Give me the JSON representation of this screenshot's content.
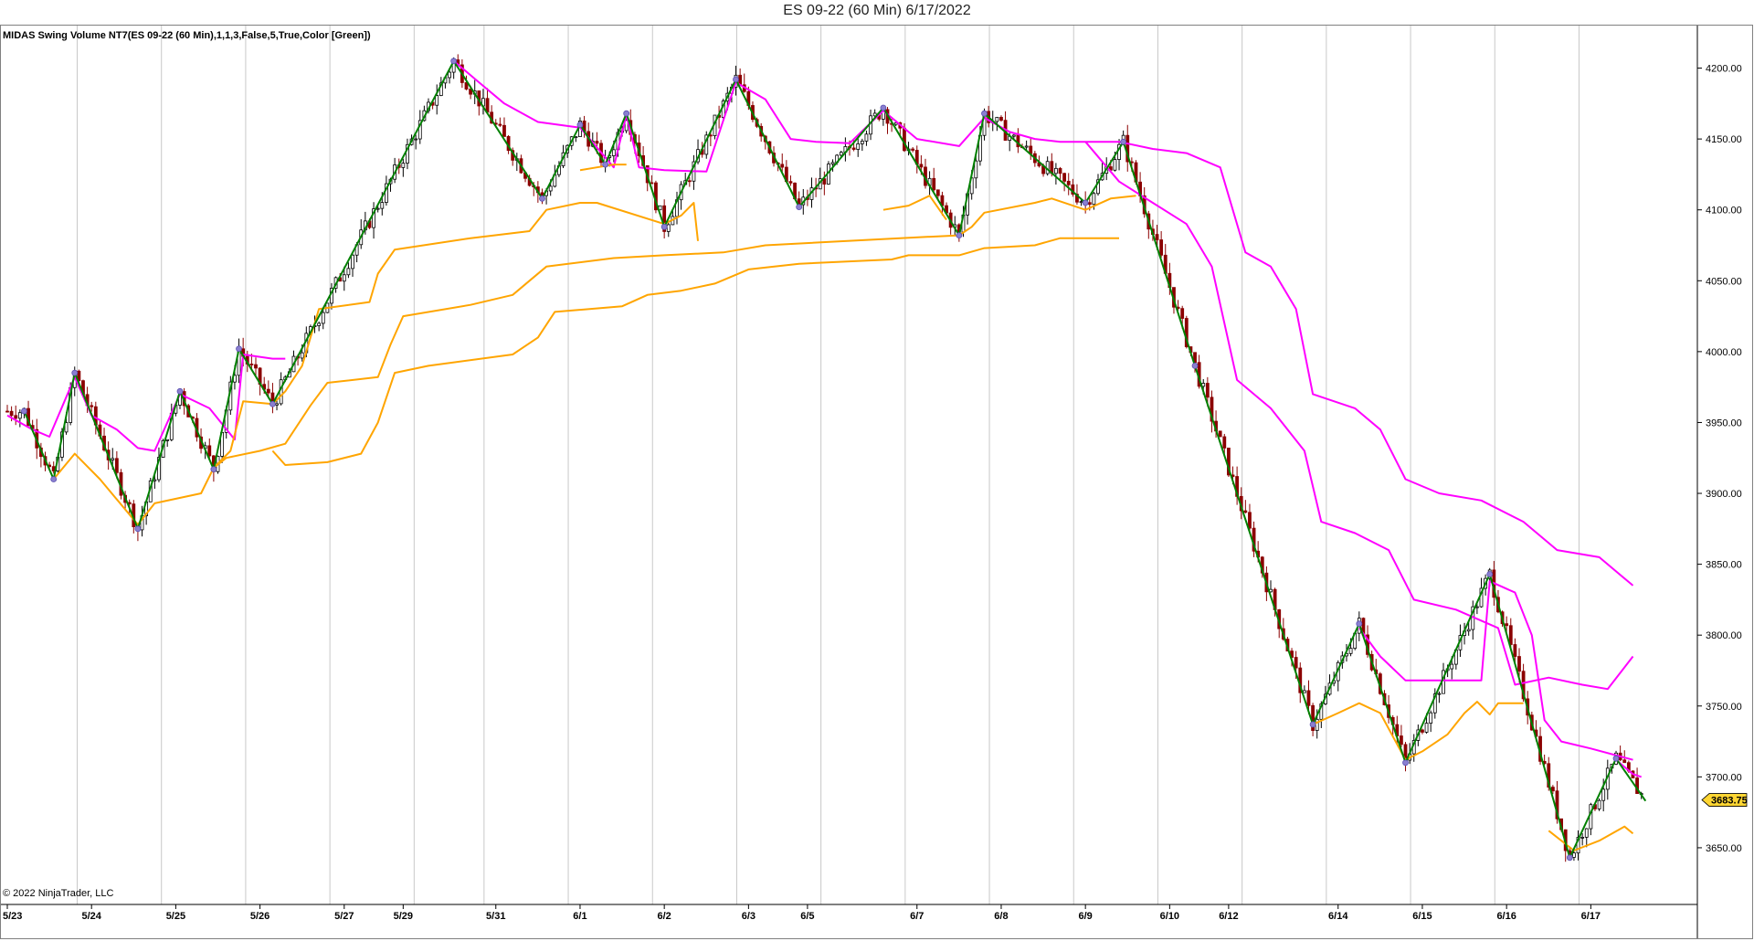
{
  "window": {
    "title": "ES 09-22 (60 Min)  6/17/2022"
  },
  "indicator": {
    "label": "MIDAS Swing Volume NT7(ES 09-22 (60 Min),1,1,3,False,5,True,Color [Green])"
  },
  "footer": {
    "copyright": "© 2022 NinjaTrader, LLC"
  },
  "colors": {
    "swing": "#008000",
    "resistance": "#ff00ff",
    "support": "#ffa500",
    "candle_up": "#000000",
    "candle_down": "#8b0000",
    "pivot_marker": "#8a7fd0",
    "price_tag": "#ffd633",
    "grid": "#c8c8c8"
  },
  "chart_data": {
    "type": "line",
    "ylim": [
      3610,
      4230
    ],
    "y_ticks": [
      "4200.00",
      "4150.00",
      "4100.00",
      "4050.00",
      "4000.00",
      "3950.00",
      "3900.00",
      "3850.00",
      "3800.00",
      "3750.00",
      "3700.00",
      "3650.00"
    ],
    "y_tick_values": [
      4200,
      4150,
      4100,
      4050,
      4000,
      3950,
      3900,
      3850,
      3800,
      3750,
      3700,
      3650
    ],
    "x_session_count": 19,
    "date_labels": [
      {
        "label": "5/23",
        "session": 0
      },
      {
        "label": "5/24",
        "session": 1
      },
      {
        "label": "5/25",
        "session": 2
      },
      {
        "label": "5/26",
        "session": 3
      },
      {
        "label": "5/27",
        "session": 4
      },
      {
        "label": "5/29",
        "session": 4.7
      },
      {
        "label": "5/31",
        "session": 5.8
      },
      {
        "label": "6/1",
        "session": 6.8
      },
      {
        "label": "6/2",
        "session": 7.8
      },
      {
        "label": "6/3",
        "session": 8.8
      },
      {
        "label": "6/5",
        "session": 9.5
      },
      {
        "label": "6/7",
        "session": 10.8
      },
      {
        "label": "6/8",
        "session": 11.8
      },
      {
        "label": "6/9",
        "session": 12.8
      },
      {
        "label": "6/10",
        "session": 13.8
      },
      {
        "label": "6/12",
        "session": 14.5
      },
      {
        "label": "6/14",
        "session": 15.8
      },
      {
        "label": "6/15",
        "session": 16.8
      },
      {
        "label": "6/16",
        "session": 17.8
      },
      {
        "label": "6/17",
        "session": 18.8
      }
    ],
    "session_lines": [
      0.83,
      1.83,
      2.83,
      3.83,
      4.83,
      5.66,
      6.66,
      7.66,
      8.66,
      9.66,
      10.66,
      11.66,
      12.66,
      13.66,
      14.66,
      15.66,
      16.66,
      17.66,
      18.66
    ],
    "last_price": "3683.75",
    "swing_pivots": [
      {
        "t": 0.2,
        "p": 3958
      },
      {
        "t": 0.55,
        "p": 3910
      },
      {
        "t": 0.8,
        "p": 3985
      },
      {
        "t": 1.55,
        "p": 3875
      },
      {
        "t": 2.05,
        "p": 3972
      },
      {
        "t": 2.45,
        "p": 3917
      },
      {
        "t": 2.75,
        "p": 4002
      },
      {
        "t": 3.15,
        "p": 3963
      },
      {
        "t": 5.3,
        "p": 4205
      },
      {
        "t": 6.35,
        "p": 4108
      },
      {
        "t": 6.8,
        "p": 4160
      },
      {
        "t": 7.1,
        "p": 4132
      },
      {
        "t": 7.35,
        "p": 4168
      },
      {
        "t": 7.8,
        "p": 4088
      },
      {
        "t": 8.65,
        "p": 4192
      },
      {
        "t": 9.4,
        "p": 4102
      },
      {
        "t": 10.4,
        "p": 4172
      },
      {
        "t": 11.3,
        "p": 4082
      },
      {
        "t": 11.6,
        "p": 4168
      },
      {
        "t": 12.8,
        "p": 4105
      },
      {
        "t": 13.25,
        "p": 4148
      },
      {
        "t": 14.1,
        "p": 3990
      },
      {
        "t": 15.5,
        "p": 3737
      },
      {
        "t": 16.05,
        "p": 3808
      },
      {
        "t": 16.6,
        "p": 3710
      },
      {
        "t": 17.6,
        "p": 3843
      },
      {
        "t": 18.55,
        "p": 3643
      },
      {
        "t": 19.1,
        "p": 3713
      },
      {
        "t": 19.45,
        "p": 3683
      }
    ],
    "series": [
      {
        "name": "",
        "color": "resistance",
        "points": [
          [
            0,
            3955
          ],
          [
            0.3,
            3945
          ],
          [
            0.5,
            3940
          ],
          [
            0.8,
            3982
          ],
          [
            1.0,
            3955
          ],
          [
            1.3,
            3945
          ],
          [
            1.55,
            3932
          ],
          [
            1.75,
            3930
          ],
          [
            2.05,
            3970
          ],
          [
            2.4,
            3960
          ],
          [
            2.7,
            3938
          ],
          [
            2.8,
            3998
          ],
          [
            3.15,
            3995
          ],
          [
            3.3,
            3995
          ]
        ]
      },
      {
        "name": "",
        "color": "resistance",
        "points": [
          [
            5.3,
            4205
          ],
          [
            5.6,
            4190
          ],
          [
            5.9,
            4175
          ],
          [
            6.3,
            4162
          ],
          [
            6.8,
            4158
          ],
          [
            7.2,
            4130
          ],
          [
            7.35,
            4167
          ],
          [
            7.5,
            4130
          ],
          [
            7.8,
            4128
          ],
          [
            8.3,
            4127
          ],
          [
            8.65,
            4190
          ],
          [
            9.0,
            4178
          ],
          [
            9.3,
            4150
          ],
          [
            9.6,
            4148
          ],
          [
            10.0,
            4147
          ],
          [
            10.4,
            4170
          ],
          [
            10.8,
            4150
          ],
          [
            11.3,
            4145
          ],
          [
            11.6,
            4165
          ],
          [
            11.9,
            4155
          ],
          [
            12.2,
            4150
          ],
          [
            12.5,
            4148
          ],
          [
            13.2,
            4148
          ],
          [
            13.6,
            4143
          ],
          [
            14.0,
            4140
          ],
          [
            14.4,
            4130
          ],
          [
            14.7,
            4070
          ],
          [
            15.0,
            4060
          ],
          [
            15.3,
            4030
          ],
          [
            15.5,
            3970
          ],
          [
            16.0,
            3960
          ],
          [
            16.3,
            3945
          ],
          [
            16.6,
            3910
          ],
          [
            17.0,
            3900
          ],
          [
            17.5,
            3895
          ],
          [
            18.0,
            3880
          ],
          [
            18.4,
            3860
          ],
          [
            18.9,
            3855
          ],
          [
            19.3,
            3835
          ]
        ]
      },
      {
        "name": "",
        "color": "resistance",
        "points": [
          [
            12.8,
            4148
          ],
          [
            13.2,
            4120
          ],
          [
            13.6,
            4105
          ],
          [
            14.0,
            4090
          ],
          [
            14.3,
            4060
          ],
          [
            14.6,
            3980
          ],
          [
            15.0,
            3960
          ],
          [
            15.4,
            3930
          ],
          [
            15.6,
            3880
          ],
          [
            16.0,
            3872
          ],
          [
            16.4,
            3860
          ],
          [
            16.7,
            3825
          ],
          [
            17.2,
            3818
          ],
          [
            17.7,
            3805
          ],
          [
            17.9,
            3765
          ],
          [
            18.3,
            3770
          ],
          [
            18.7,
            3765
          ],
          [
            19.0,
            3762
          ],
          [
            19.3,
            3785
          ]
        ]
      },
      {
        "name": "",
        "color": "resistance",
        "points": [
          [
            16.05,
            3805
          ],
          [
            16.3,
            3785
          ],
          [
            16.6,
            3768
          ],
          [
            17.0,
            3768
          ],
          [
            17.5,
            3768
          ],
          [
            17.6,
            3838
          ],
          [
            17.9,
            3830
          ],
          [
            18.1,
            3800
          ],
          [
            18.25,
            3740
          ],
          [
            18.45,
            3725
          ],
          [
            18.8,
            3720
          ],
          [
            19.3,
            3712
          ]
        ]
      },
      {
        "name": "",
        "color": "resistance",
        "points": [
          [
            19.1,
            3712
          ],
          [
            19.3,
            3702
          ],
          [
            19.4,
            3700
          ]
        ]
      },
      {
        "name": "",
        "color": "support",
        "points": [
          [
            0.55,
            3910
          ],
          [
            0.8,
            3928
          ],
          [
            1.1,
            3910
          ],
          [
            1.55,
            3878
          ],
          [
            1.75,
            3893
          ],
          [
            2.3,
            3900
          ],
          [
            2.45,
            3918
          ],
          [
            2.65,
            3930
          ],
          [
            2.8,
            3965
          ],
          [
            3.15,
            3963
          ],
          [
            3.3,
            3972
          ],
          [
            3.5,
            3990
          ],
          [
            3.7,
            4030
          ],
          [
            4.3,
            4035
          ],
          [
            4.4,
            4055
          ],
          [
            4.6,
            4072
          ],
          [
            5.5,
            4080
          ],
          [
            6.2,
            4085
          ],
          [
            6.4,
            4100
          ],
          [
            6.8,
            4105
          ],
          [
            7.0,
            4105
          ],
          [
            7.8,
            4090
          ],
          [
            8.0,
            4096
          ],
          [
            8.15,
            4105
          ],
          [
            8.2,
            4078
          ]
        ]
      },
      {
        "name": "",
        "color": "support",
        "points": [
          [
            2.45,
            3918
          ],
          [
            2.6,
            3925
          ],
          [
            3.0,
            3930
          ],
          [
            3.3,
            3935
          ],
          [
            3.6,
            3962
          ],
          [
            3.8,
            3978
          ],
          [
            4.4,
            3982
          ],
          [
            4.55,
            4005
          ],
          [
            4.7,
            4025
          ],
          [
            5.5,
            4033
          ],
          [
            6.0,
            4040
          ],
          [
            6.2,
            4050
          ],
          [
            6.4,
            4060
          ],
          [
            7.2,
            4066
          ],
          [
            7.8,
            4068
          ],
          [
            8.5,
            4070
          ],
          [
            9.0,
            4075
          ],
          [
            10.6,
            4080
          ],
          [
            11.3,
            4082
          ],
          [
            11.45,
            4088
          ],
          [
            11.6,
            4098
          ],
          [
            12.2,
            4105
          ],
          [
            12.4,
            4108
          ],
          [
            12.8,
            4100
          ],
          [
            13.1,
            4108
          ],
          [
            13.4,
            4110
          ]
        ]
      },
      {
        "name": "",
        "color": "support",
        "points": [
          [
            3.15,
            3930
          ],
          [
            3.3,
            3920
          ],
          [
            3.8,
            3922
          ],
          [
            4.2,
            3928
          ],
          [
            4.4,
            3950
          ],
          [
            4.6,
            3985
          ],
          [
            5.0,
            3990
          ],
          [
            6.0,
            3998
          ],
          [
            6.3,
            4010
          ],
          [
            6.5,
            4028
          ],
          [
            7.3,
            4032
          ],
          [
            7.6,
            4040
          ],
          [
            8.0,
            4043
          ],
          [
            8.4,
            4048
          ],
          [
            8.8,
            4058
          ],
          [
            9.4,
            4062
          ],
          [
            10.5,
            4065
          ],
          [
            10.7,
            4068
          ],
          [
            11.3,
            4068
          ],
          [
            11.6,
            4073
          ],
          [
            12.2,
            4075
          ],
          [
            12.5,
            4080
          ],
          [
            13.2,
            4080
          ]
        ]
      },
      {
        "name": "",
        "color": "support",
        "points": [
          [
            6.8,
            4128
          ],
          [
            7.0,
            4130
          ],
          [
            7.2,
            4132
          ],
          [
            7.35,
            4132
          ]
        ]
      },
      {
        "name": "",
        "color": "support",
        "points": [
          [
            10.4,
            4100
          ],
          [
            10.7,
            4103
          ],
          [
            10.95,
            4110
          ],
          [
            11.15,
            4093
          ]
        ]
      },
      {
        "name": "",
        "color": "support",
        "points": [
          [
            15.5,
            3737
          ],
          [
            15.8,
            3745
          ],
          [
            16.05,
            3752
          ],
          [
            16.3,
            3745
          ],
          [
            16.6,
            3712
          ],
          [
            16.8,
            3718
          ],
          [
            17.1,
            3730
          ],
          [
            17.3,
            3745
          ],
          [
            17.45,
            3753
          ],
          [
            17.6,
            3744
          ],
          [
            17.7,
            3752
          ],
          [
            18.0,
            3752
          ]
        ]
      },
      {
        "name": "",
        "color": "support",
        "points": [
          [
            18.3,
            3662
          ],
          [
            18.6,
            3648
          ],
          [
            18.9,
            3655
          ],
          [
            19.2,
            3665
          ],
          [
            19.3,
            3660
          ]
        ]
      }
    ]
  }
}
